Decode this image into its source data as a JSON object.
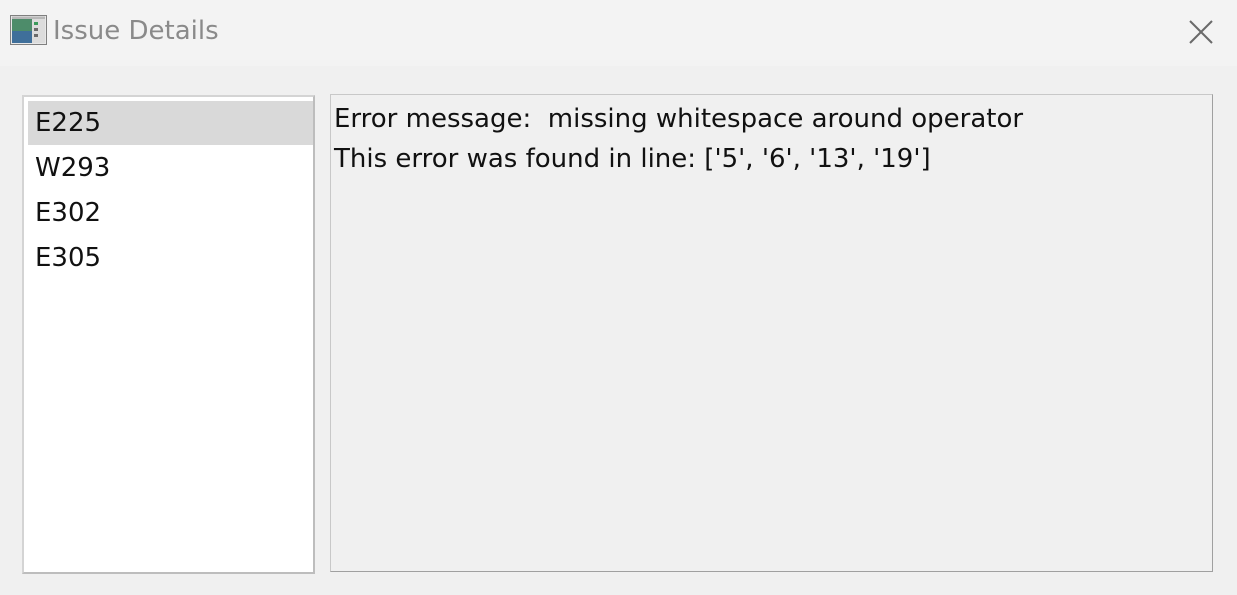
{
  "window": {
    "title": "Issue Details",
    "icon": "app-window-icon",
    "close_icon": "close-icon"
  },
  "issue_list": {
    "items": [
      {
        "label": "E225",
        "selected": true
      },
      {
        "label": "W293",
        "selected": false
      },
      {
        "label": "E302",
        "selected": false
      },
      {
        "label": "E305",
        "selected": false
      }
    ]
  },
  "details": {
    "message_line": "Error message:  missing whitespace around operator",
    "location_line": "This error was found in line: ['5', '6', '13', '19']"
  },
  "colors": {
    "selection": "#d9d9d9",
    "window_bg": "#f0f0f0",
    "title_text": "#8a8a8a"
  }
}
